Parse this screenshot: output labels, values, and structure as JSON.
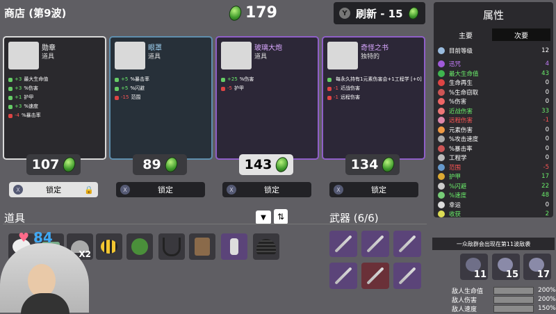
{
  "shop": {
    "title": "商店 (第9波)",
    "gold": "179",
    "reroll_label": "刷新 - 15",
    "reroll_key": "Y"
  },
  "cards": [
    {
      "name": "勋章",
      "type": "道具",
      "price": "107",
      "lock": "锁定",
      "border": "#d9d9d9",
      "bg": "#2a292d",
      "stats": [
        [
          "g",
          "+3",
          "最大生命值"
        ],
        [
          "g",
          "+3",
          "%伤害"
        ],
        [
          "g",
          "+1",
          "护甲"
        ],
        [
          "g",
          "+3",
          "%速度"
        ],
        [
          "r",
          "-4",
          "%暴击率"
        ]
      ]
    },
    {
      "name": "眼罩",
      "type": "道具",
      "price": "89",
      "lock": "锁定",
      "border": "#5f8fae",
      "bg": "#273039",
      "stats": [
        [
          "g",
          "+5",
          "%暴击率"
        ],
        [
          "g",
          "+5",
          "%闪避"
        ],
        [
          "r",
          "-15",
          "范围"
        ]
      ]
    },
    {
      "name": "玻璃大炮",
      "type": "道具",
      "price": "143",
      "lock": "锁定",
      "border": "#8f5fc8",
      "bg": "#2c2737",
      "stats": [
        [
          "g",
          "+25",
          "%伤害"
        ],
        [
          "r",
          "-5",
          "护甲"
        ]
      ]
    },
    {
      "name": "奇怪之书",
      "type": "独特的",
      "price": "134",
      "lock": "锁定",
      "border": "#8f5fc8",
      "bg": "#2c2737",
      "stats": [
        [
          "w",
          "",
          "每永久持有1元素伤害会+1工程学 [+0]"
        ],
        [
          "r",
          "-1",
          "近战伤害"
        ],
        [
          "r",
          "-1",
          "远程伤害"
        ]
      ]
    }
  ],
  "items_label": "道具",
  "weapons_label": "武器 (6/6)",
  "items_stack": "X2",
  "hp_overlay": "84",
  "attributes": {
    "title": "属性",
    "tab_main": "主要",
    "tab_secondary": "次要",
    "rows": [
      {
        "label": "目前等级",
        "value": "12",
        "color": "#fff",
        "icon": "#9bd"
      },
      {
        "label": "迅咒",
        "value": "4",
        "color": "#c77dff",
        "icon": "#a05ad8"
      },
      {
        "label": "最大生命值",
        "value": "43",
        "color": "#6bf06b",
        "icon": "#3fb44f"
      },
      {
        "label": "生命再生",
        "value": "0",
        "color": "#fff",
        "icon": "#d44"
      },
      {
        "label": "%生命窃取",
        "value": "0",
        "color": "#fff",
        "icon": "#c55"
      },
      {
        "label": "%伤害",
        "value": "0",
        "color": "#fff",
        "icon": "#e66"
      },
      {
        "label": "近战伤害",
        "value": "33",
        "color": "#6bf06b",
        "icon": "#e77"
      },
      {
        "label": "远程伤害",
        "value": "-1",
        "color": "#ff5555",
        "icon": "#d8a"
      },
      {
        "label": "元素伤害",
        "value": "0",
        "color": "#fff",
        "icon": "#e94"
      },
      {
        "label": "%攻击速度",
        "value": "0",
        "color": "#fff",
        "icon": "#aaa"
      },
      {
        "label": "%暴击率",
        "value": "0",
        "color": "#fff",
        "icon": "#c55"
      },
      {
        "label": "工程学",
        "value": "0",
        "color": "#fff",
        "icon": "#bbb"
      },
      {
        "label": "范围",
        "value": "-5",
        "color": "#ff5555",
        "icon": "#69c"
      },
      {
        "label": "护甲",
        "value": "17",
        "color": "#6bf06b",
        "icon": "#da3"
      },
      {
        "label": "%闪避",
        "value": "22",
        "color": "#6bf06b",
        "icon": "#ccc"
      },
      {
        "label": "%速度",
        "value": "48",
        "color": "#6bf06b",
        "icon": "#7c7"
      },
      {
        "label": "幸运",
        "value": "0",
        "color": "#fff",
        "icon": "#ddd"
      },
      {
        "label": "收获",
        "value": "2",
        "color": "#6bf06b",
        "icon": "#dd5"
      }
    ]
  },
  "wave_banner": "一众敌群会出现在第11波敌袭",
  "enemies": [
    "11",
    "15",
    "17"
  ],
  "enemy_stats": [
    {
      "label": "敌人生命值",
      "value": "200%"
    },
    {
      "label": "敌人伤害",
      "value": "200%"
    },
    {
      "label": "敌人速度",
      "value": "150%"
    }
  ]
}
